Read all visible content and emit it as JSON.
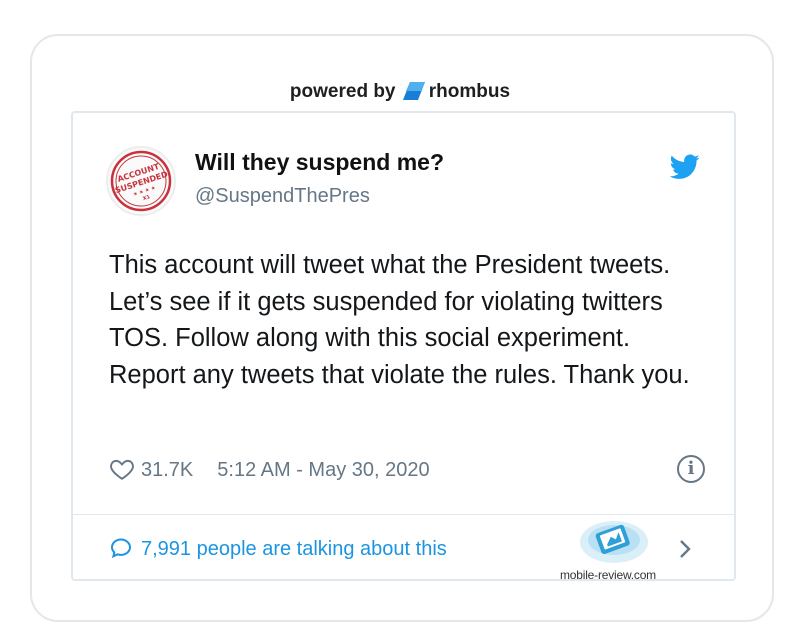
{
  "powered_by": {
    "prefix": "powered by",
    "brand": "rhombus",
    "brand_color": "#1a7fd4",
    "icon": "rhombus-logo-icon"
  },
  "tweet": {
    "avatar": {
      "icon": "account-suspended-stamp",
      "stamp_line1": "ACCOUNT",
      "stamp_line2": "SUSPENDED",
      "stamp_small": "X1",
      "stamp_color": "#c8323c"
    },
    "display_name": "Will they suspend me?",
    "handle": "@SuspendThePres",
    "text": "This account will tweet what the President tweets. Let’s see if it gets suspended for violating twitters TOS. Follow along with this social experiment. Report any tweets that violate the rules. Thank you.",
    "like_icon": "heart-icon",
    "likes": "31.7K",
    "timestamp": "5:12 AM - May 30, 2020",
    "info_icon": "info-icon",
    "info_glyph": "i",
    "platform_icon": "twitter-bird-icon",
    "accent_color": "#1da1f2"
  },
  "footer": {
    "talking_icon": "speech-bubble-icon",
    "talking_text": "7,991 people are talking about this",
    "chevron_icon": "chevron-right-icon"
  },
  "watermark": {
    "text": "mobile-review.com",
    "icon": "mobile-review-logo-icon"
  }
}
